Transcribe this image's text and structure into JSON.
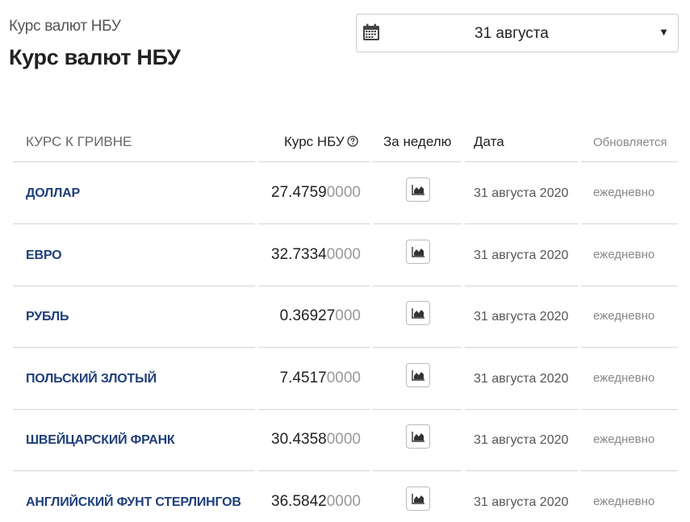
{
  "header": {
    "subtitle": "Курс валют НБУ",
    "title": "Курс валют НБУ"
  },
  "date_select": {
    "icon": "calendar-icon",
    "value": "31 августа",
    "caret": "▼"
  },
  "table": {
    "headers": {
      "name": "КУРС К ГРИВНЕ",
      "rate": "Курс НБУ",
      "week": "За неделю",
      "date": "Дата",
      "updated": "Обновляется"
    },
    "rows": [
      {
        "name": "ДОЛЛАР",
        "rate_main": "27.4759",
        "rate_rest": "0000",
        "date": "31 августа 2020",
        "updated": "ежедневно"
      },
      {
        "name": "ЕВРО",
        "rate_main": "32.7334",
        "rate_rest": "0000",
        "date": "31 августа 2020",
        "updated": "ежедневно"
      },
      {
        "name": "РУБЛЬ",
        "rate_main": "0.36927",
        "rate_rest": "000",
        "date": "31 августа 2020",
        "updated": "ежедневно"
      },
      {
        "name": "ПОЛЬСКИЙ ЗЛОТЫЙ",
        "rate_main": "7.4517",
        "rate_rest": "0000",
        "date": "31 августа 2020",
        "updated": "ежедневно"
      },
      {
        "name": "ШВЕЙЦАРСКИЙ ФРАНК",
        "rate_main": "30.4358",
        "rate_rest": "0000",
        "date": "31 августа 2020",
        "updated": "ежедневно"
      },
      {
        "name": "АНГЛИЙСКИЙ ФУНТ СТЕРЛИНГОВ",
        "rate_main": "36.5842",
        "rate_rest": "0000",
        "date": "31 августа 2020",
        "updated": "ежедневно"
      }
    ]
  },
  "colors": {
    "link": "#1f3f7a",
    "rate_rest": "#999999",
    "divider": "#d5d5d5"
  }
}
